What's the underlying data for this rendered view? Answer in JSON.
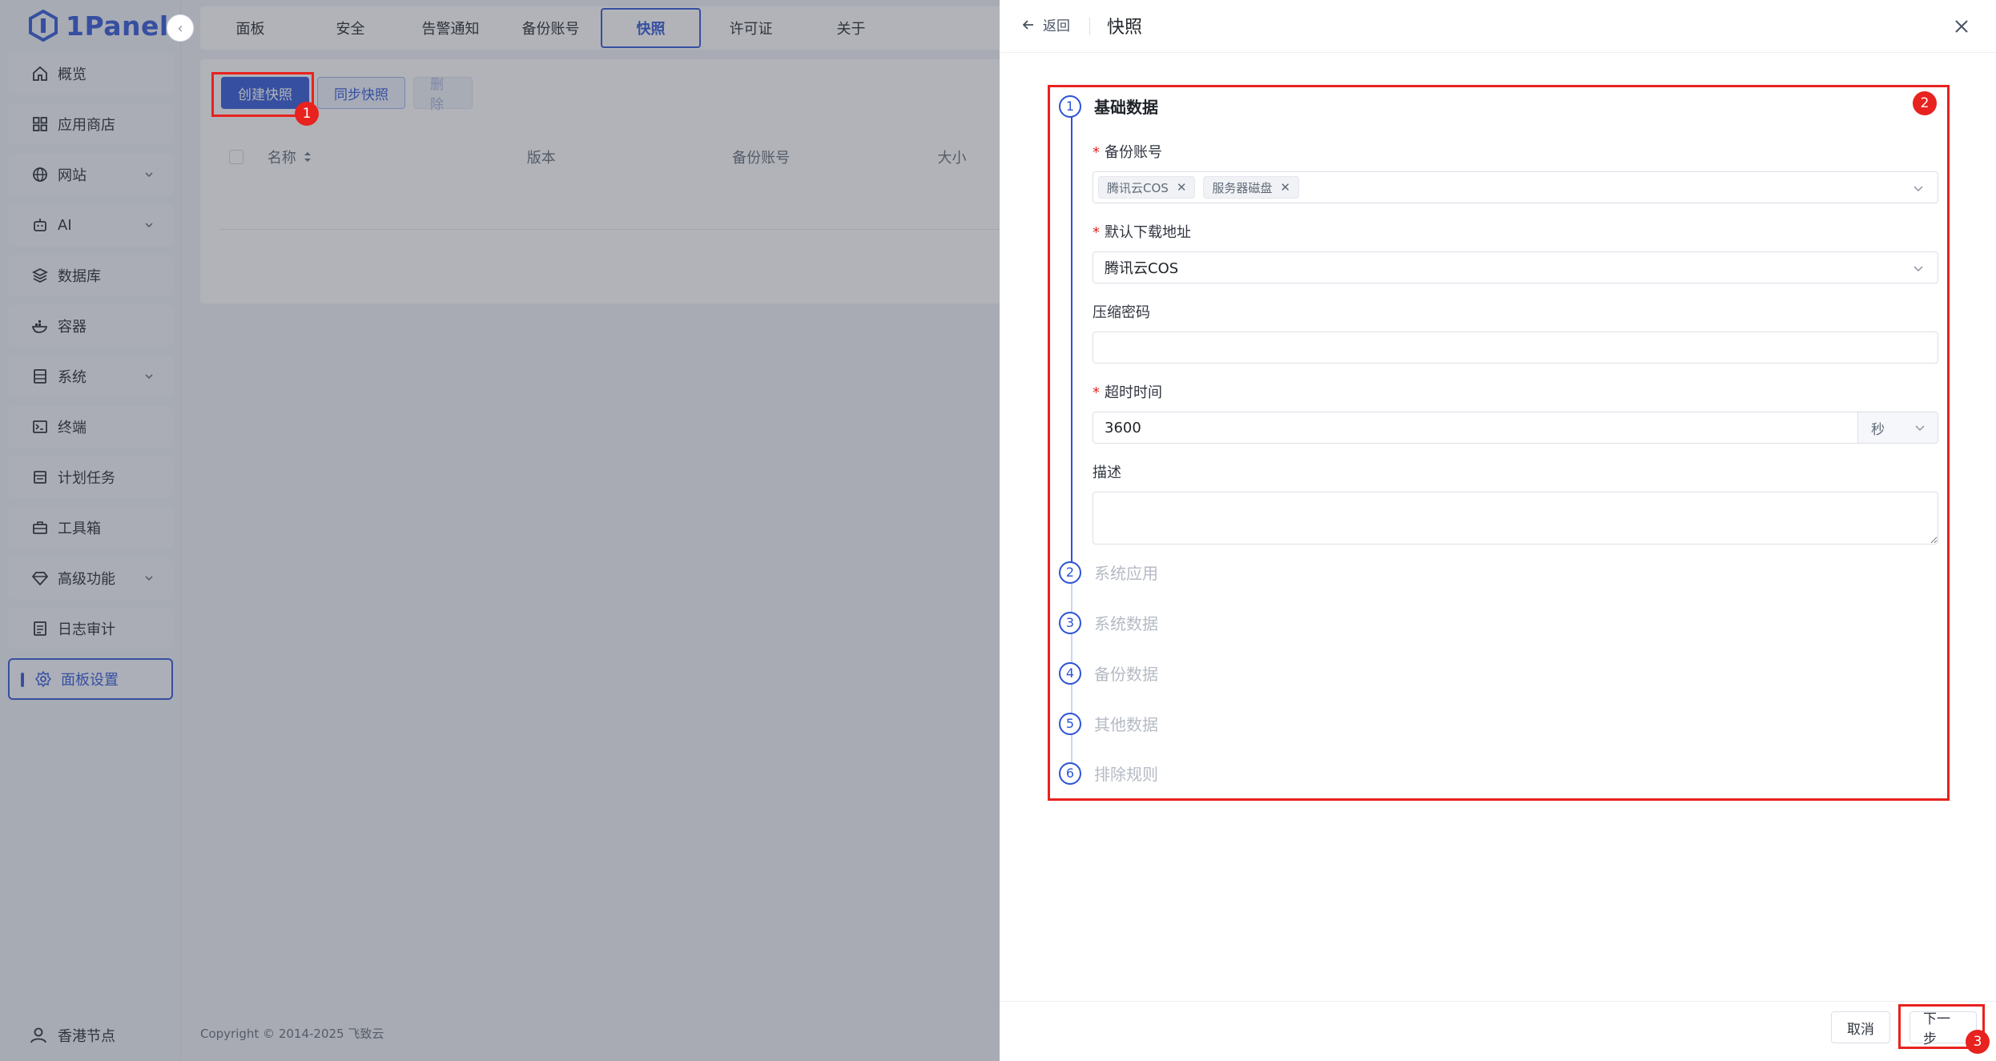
{
  "app": {
    "logo_text": "1Panel",
    "brand_color": "#2c53d6"
  },
  "sidebar": {
    "items": [
      {
        "label": "概览",
        "icon": "home-icon",
        "has_arrow": false
      },
      {
        "label": "应用商店",
        "icon": "grid-icon",
        "has_arrow": false
      },
      {
        "label": "网站",
        "icon": "globe-icon",
        "has_arrow": true
      },
      {
        "label": "AI",
        "icon": "robot-icon",
        "has_arrow": true
      },
      {
        "label": "数据库",
        "icon": "layers-icon",
        "has_arrow": false
      },
      {
        "label": "容器",
        "icon": "docker-icon",
        "has_arrow": false
      },
      {
        "label": "系统",
        "icon": "server-icon",
        "has_arrow": true
      },
      {
        "label": "终端",
        "icon": "terminal-icon",
        "has_arrow": false
      },
      {
        "label": "计划任务",
        "icon": "calendar-icon",
        "has_arrow": false
      },
      {
        "label": "工具箱",
        "icon": "toolbox-icon",
        "has_arrow": false
      },
      {
        "label": "高级功能",
        "icon": "diamond-icon",
        "has_arrow": true
      },
      {
        "label": "日志审计",
        "icon": "log-icon",
        "has_arrow": false
      },
      {
        "label": "面板设置",
        "icon": "gear-icon",
        "has_arrow": false,
        "active": true
      }
    ],
    "node_label": "香港节点"
  },
  "topbar": {
    "tabs": [
      "面板",
      "安全",
      "告警通知",
      "备份账号",
      "快照",
      "许可证",
      "关于"
    ],
    "active_tab": "快照"
  },
  "toolbar": {
    "create_label": "创建快照",
    "sync_label": "同步快照",
    "delete_label": "删除"
  },
  "table": {
    "columns": [
      "名称",
      "版本",
      "备份账号",
      "大小"
    ]
  },
  "footer": {
    "copyright": "Copyright © 2014-2025 飞致云"
  },
  "drawer": {
    "back_label": "返回",
    "title": "快照",
    "steps": [
      {
        "num": "1",
        "label": "基础数据"
      },
      {
        "num": "2",
        "label": "系统应用"
      },
      {
        "num": "3",
        "label": "系统数据"
      },
      {
        "num": "4",
        "label": "备份数据"
      },
      {
        "num": "5",
        "label": "其他数据"
      },
      {
        "num": "6",
        "label": "排除规则"
      }
    ],
    "form": {
      "backup_account_label": "备份账号",
      "backup_account_tags": [
        "腾讯云COS",
        "服务器磁盘"
      ],
      "download_label": "默认下载地址",
      "download_value": "腾讯云COS",
      "password_label": "压缩密码",
      "password_value": "",
      "timeout_label": "超时时间",
      "timeout_value": "3600",
      "timeout_unit": "秒",
      "desc_label": "描述",
      "desc_value": ""
    },
    "cancel_label": "取消",
    "next_label": "下一步"
  },
  "annotations": {
    "badge1": "1",
    "badge2": "2",
    "badge3": "3",
    "highlight_color": "#e8221f"
  }
}
